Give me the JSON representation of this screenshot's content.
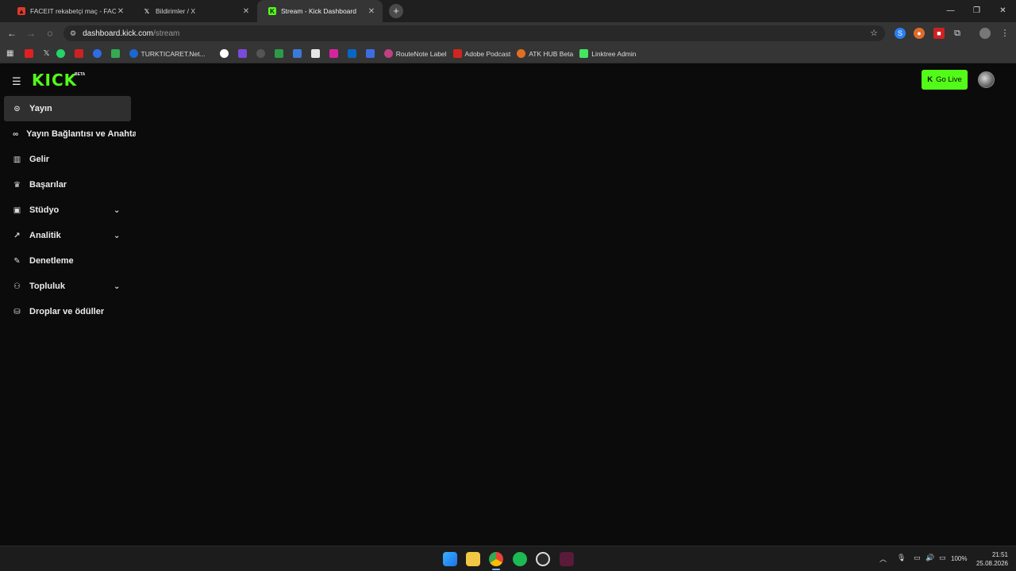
{
  "browser": {
    "tabs": [
      {
        "title": "FACEIT rekabetçi maç - FACEIT.",
        "icon": "faceit-icon"
      },
      {
        "title": "Bildirimler / X",
        "icon": "x-icon"
      },
      {
        "title": "Stream - Kick Dashboard",
        "icon": "kick-icon"
      }
    ],
    "new_tab": "+",
    "url_host": "dashboard.kick.com",
    "url_path": "/stream",
    "bookmarks": [
      {
        "label": "TURKTICARET.Net...",
        "color": "#1e66d0"
      },
      {
        "label": "RouteNote Label",
        "color": "#c04080"
      },
      {
        "label": "Adobe Podcast",
        "color": "#d0261f"
      },
      {
        "label": "ATK HUB Beta",
        "color": "#e07020"
      },
      {
        "label": "Linktree Admin",
        "color": "#43e660"
      }
    ]
  },
  "page": {
    "logo": "KICK",
    "beta": "BETA",
    "go_live": "Go Live",
    "accent": "#53fc18",
    "nav": [
      {
        "label": "Yayın",
        "icon": "broadcast-icon",
        "active": true
      },
      {
        "label": "Yayın Bağlantısı ve Anahtarı",
        "icon": "link-icon"
      },
      {
        "label": "Gelir",
        "icon": "revenue-icon"
      },
      {
        "label": "Başarılar",
        "icon": "trophy-icon"
      },
      {
        "label": "Stüdyo",
        "icon": "studio-icon",
        "expandable": true
      },
      {
        "label": "Analitik",
        "icon": "analytics-icon",
        "expandable": true
      },
      {
        "label": "Denetleme",
        "icon": "wrench-icon"
      },
      {
        "label": "Topluluk",
        "icon": "community-icon",
        "expandable": true
      },
      {
        "label": "Droplar ve ödüller",
        "icon": "drops-icon"
      }
    ]
  },
  "taskbar": {
    "battery": "100%",
    "time": "21:51",
    "date": "25.08.2026"
  }
}
